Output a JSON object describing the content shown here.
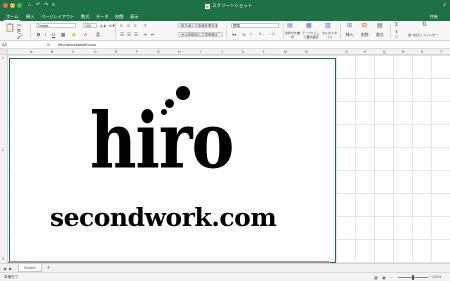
{
  "window": {
    "title": "スクリーンショット",
    "app_badge": "X"
  },
  "quick_access": [
    "⌂",
    "↶",
    "↷",
    "≡"
  ],
  "ribbon_tabs": [
    "ホーム",
    "挿入",
    "ページレイアウト",
    "数式",
    "データ",
    "校閲",
    "表示"
  ],
  "share_label": "共有",
  "ribbon": {
    "font_name": "Osaka",
    "font_size": "100",
    "wrap_text": "折り返して全体を表示する",
    "merge_center": "セルを結合して中央揃え",
    "number_format": "標準",
    "conditional_format": "条件付き書式",
    "format_as_table": "テーブルとして書式設定",
    "cell_styles": "セルのスタイル",
    "insert": "挿入",
    "delete": "削除",
    "format": "書式",
    "sort_filter": "並べ替えとフィルター"
  },
  "formula_bar": {
    "cell_ref": "A2",
    "fx": "fx",
    "content": "hiro-secondwork.com"
  },
  "columns": [
    "A",
    "B",
    "C",
    "D",
    "E",
    "F",
    "G",
    "H",
    "I",
    "J",
    "K",
    "L",
    "M",
    "N",
    "O",
    "P",
    "Q",
    "R",
    "S",
    "T"
  ],
  "rows": [
    "1",
    "2",
    "3"
  ],
  "image_text": {
    "line1": "hiro",
    "line2": "secondwork.com"
  },
  "sheets": {
    "active": "Sheet1",
    "add": "+"
  },
  "status": {
    "ready": "準備完了",
    "zoom": "100%",
    "zoom_value": 100
  }
}
